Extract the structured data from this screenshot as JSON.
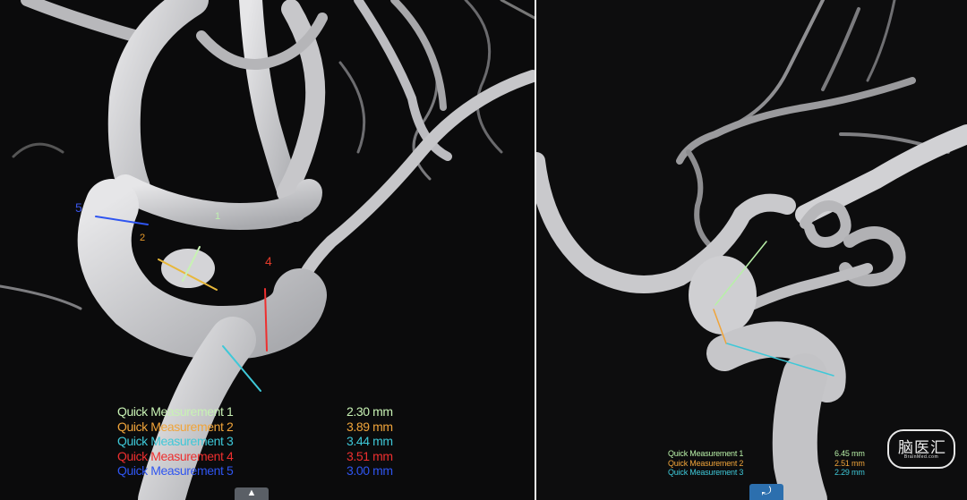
{
  "left_panel": {
    "labels": [
      {
        "text": "5",
        "color": "#3a55e8"
      },
      {
        "text": "2",
        "color": "#e89a2a"
      },
      {
        "text": "1",
        "color": "#bff0b0"
      },
      {
        "text": "4",
        "color": "#e03a2a"
      }
    ],
    "measurements": [
      {
        "name": "Quick Measurement 1",
        "value": "2.30 mm",
        "color": "#c8f2b4"
      },
      {
        "name": "Quick Measurement 2",
        "value": "3.89 mm",
        "color": "#f0a43a"
      },
      {
        "name": "Quick Measurement 3",
        "value": "3.44 mm",
        "color": "#3ec8d8"
      },
      {
        "name": "Quick Measurement 4",
        "value": "3.51 mm",
        "color": "#ee2f2f"
      },
      {
        "name": "Quick Measurement 5",
        "value": "3.00 mm",
        "color": "#2f55f0"
      }
    ],
    "bottom_tab_icon": "triangle-up-icon"
  },
  "right_panel": {
    "measurements": [
      {
        "name": "Quick Measurement 1",
        "value": "6.45 mm",
        "color": "#b8f0a8"
      },
      {
        "name": "Quick Measurement 2",
        "value": "2.51 mm",
        "color": "#f0a43a"
      },
      {
        "name": "Quick Measurement 3",
        "value": "2.29 mm",
        "color": "#3ec8d8"
      }
    ],
    "bottom_tab_icon": "rotate-arrow-icon"
  },
  "watermark": {
    "logo_text": "脑医汇",
    "logo_sub": "BrainMed.com"
  }
}
